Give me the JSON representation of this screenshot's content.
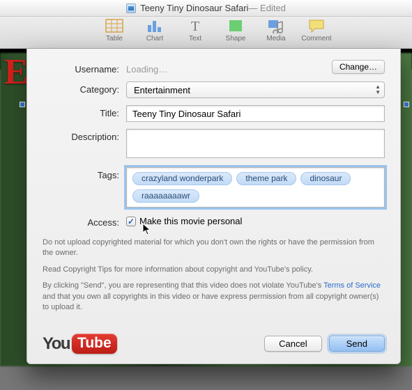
{
  "window": {
    "title": "Teeny Tiny Dinosaur Safari",
    "edited_suffix": " — Edited"
  },
  "toolbar": {
    "items": [
      {
        "name": "table",
        "label": "Table"
      },
      {
        "name": "chart",
        "label": "Chart"
      },
      {
        "name": "text",
        "label": "Text"
      },
      {
        "name": "shape",
        "label": "Shape"
      },
      {
        "name": "media",
        "label": "Media"
      },
      {
        "name": "comment",
        "label": "Comment"
      }
    ]
  },
  "bg": {
    "letter": "E"
  },
  "form": {
    "rows": {
      "username": {
        "label": "Username:",
        "value": "Loading…",
        "change_btn": "Change…"
      },
      "category": {
        "label": "Category:",
        "value": "Entertainment"
      },
      "title": {
        "label": "Title:",
        "value": "Teeny Tiny Dinosaur Safari"
      },
      "description": {
        "label": "Description:",
        "value": ""
      },
      "tags": {
        "label": "Tags:",
        "items": [
          "crazyland wonderpark",
          "theme park",
          "dinosaur",
          "raaaaaaaawr"
        ]
      },
      "access": {
        "label": "Access:",
        "checkbox_label": "Make this movie personal",
        "checked": true
      }
    }
  },
  "legal": {
    "copyright_warning": "Do not upload copyrighted material for which you don't own the rights or have the permission from the owner.",
    "copyright_tips": "Read Copyright Tips for more information about copyright and YouTube's policy.",
    "send_agreement_pre": "By clicking \"Send\", you are representing that this video does not violate YouTube's ",
    "tos_link": "Terms of Service",
    "send_agreement_post": " and that you own all copyrights in this video or have express permission from all copyright owner(s) to upload it."
  },
  "footer": {
    "logo_you": "You",
    "logo_tube": "Tube",
    "cancel": "Cancel",
    "send": "Send"
  }
}
